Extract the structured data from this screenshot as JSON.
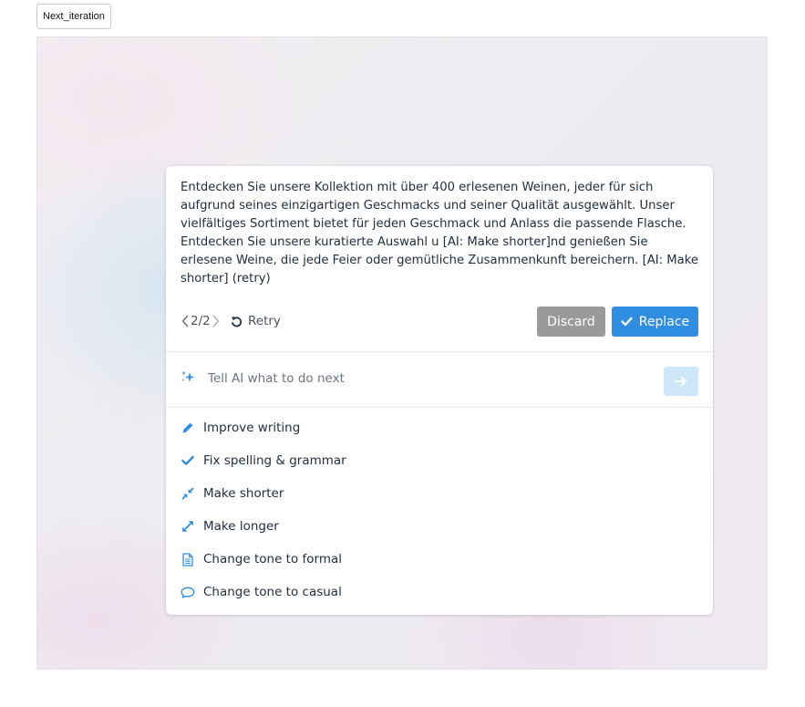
{
  "toolbar": {
    "next_iteration_label": "Next_iteration"
  },
  "colors": {
    "accent": "#2f8ee1",
    "discard": "#9a9a9a",
    "send_disabled": "#cde6f8",
    "text": "#222f3e"
  },
  "result": {
    "text": "Entdecken Sie unsere Kollektion mit über 400 erlesenen Weinen, jeder für sich aufgrund seines einzigartigen Geschmacks und seiner Qualität ausgewählt. Unser vielfältiges Sortiment bietet für jeden Geschmack und Anlass die passende Flasche. Entdecken Sie unsere kuratierte Auswahl u [AI: Make shorter]nd genießen Sie erlesene Weine, die jede Feier oder gemütliche Zusammenkunft bereichern. [AI: Make shorter] (retry)"
  },
  "navigation": {
    "counter": "2/2",
    "prev_icon": "chevron-left-icon",
    "next_icon": "chevron-right-icon"
  },
  "actions": {
    "retry_label": "Retry",
    "retry_icon": "undo-icon",
    "discard_label": "Discard",
    "replace_label": "Replace",
    "replace_icon": "check-icon"
  },
  "prompt": {
    "placeholder": "Tell AI what to do next",
    "value": "",
    "icon": "sparkle-icon",
    "send_icon": "arrow-right-icon"
  },
  "menu": {
    "items": [
      {
        "label": "Improve writing",
        "icon": "pencil-icon"
      },
      {
        "label": "Fix spelling & grammar",
        "icon": "check-icon"
      },
      {
        "label": "Make shorter",
        "icon": "shrink-icon"
      },
      {
        "label": "Make longer",
        "icon": "expand-icon"
      },
      {
        "label": "Change tone to formal",
        "icon": "document-icon"
      },
      {
        "label": "Change tone to casual",
        "icon": "speech-bubble-icon"
      }
    ]
  }
}
